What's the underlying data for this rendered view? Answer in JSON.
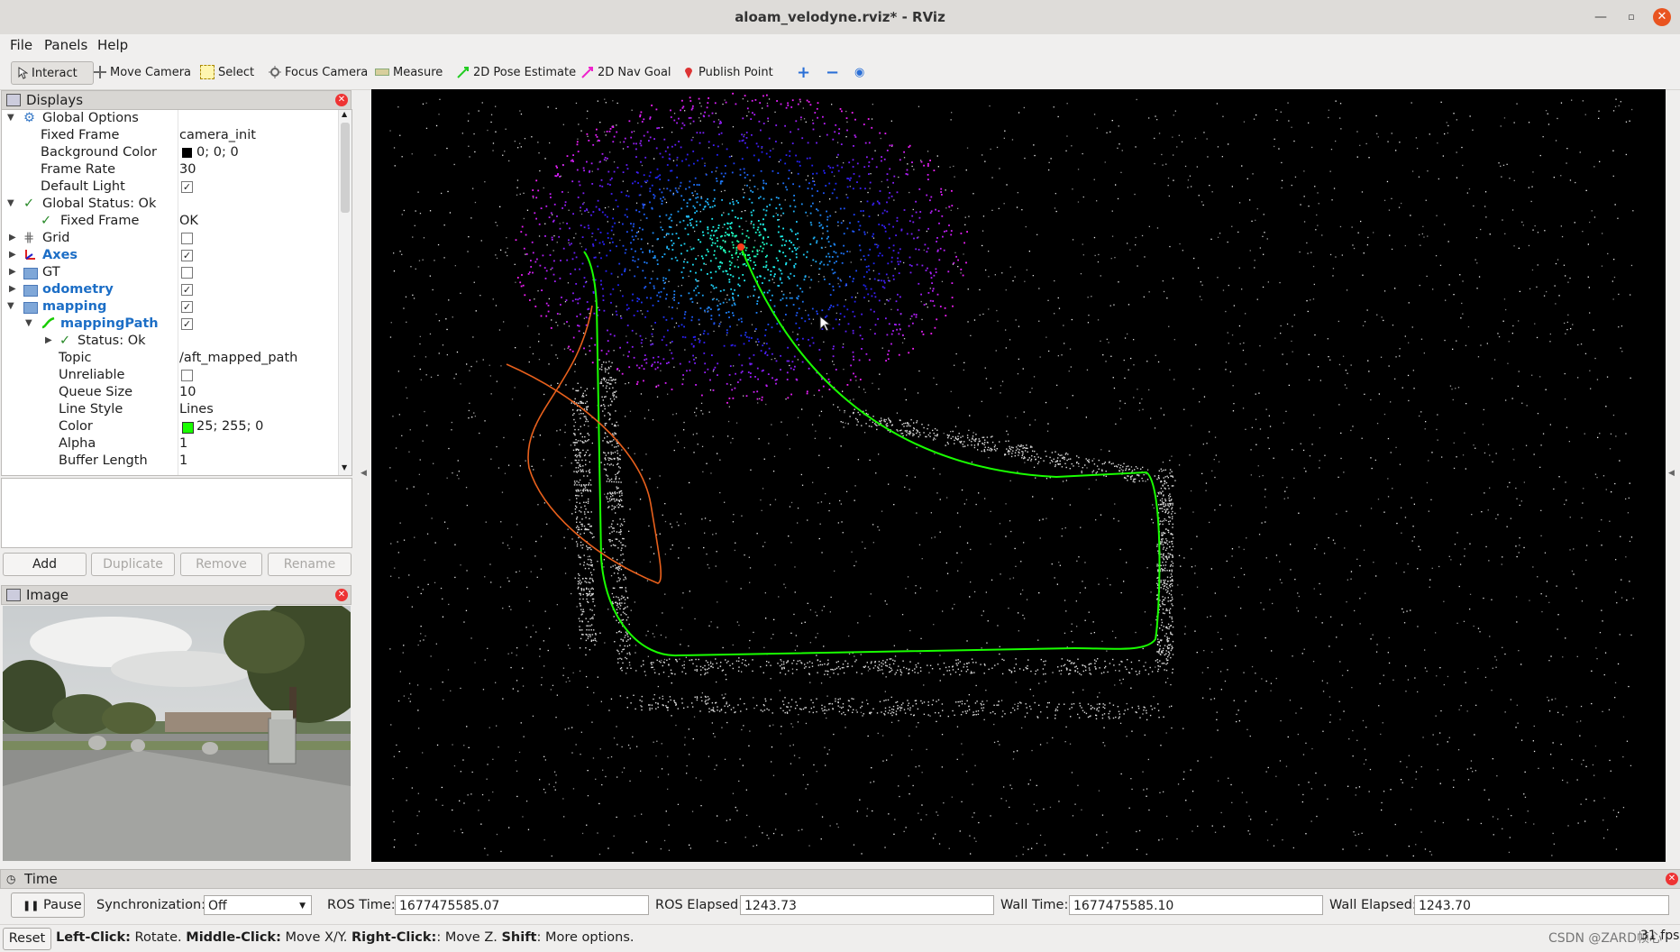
{
  "window": {
    "title": "aloam_velodyne.rviz* - RViz"
  },
  "menu": [
    "File",
    "Panels",
    "Help"
  ],
  "toolbar": {
    "interact": "Interact",
    "move_camera": "Move Camera",
    "select": "Select",
    "focus_camera": "Focus Camera",
    "measure": "Measure",
    "pose_estimate": "2D Pose Estimate",
    "nav_goal": "2D Nav Goal",
    "publish_point": "Publish Point"
  },
  "displays": {
    "title": "Displays",
    "rows": [
      {
        "name": "Global Options",
        "value": ""
      },
      {
        "name": "Fixed Frame",
        "value": "camera_init"
      },
      {
        "name": "Background Color",
        "value": "0; 0; 0"
      },
      {
        "name": "Frame Rate",
        "value": "30"
      },
      {
        "name": "Default Light",
        "value": ""
      },
      {
        "name": "Global Status: Ok",
        "value": ""
      },
      {
        "name": "Fixed Frame",
        "value": "OK"
      },
      {
        "name": "Grid",
        "value": ""
      },
      {
        "name": "Axes",
        "value": ""
      },
      {
        "name": "GT",
        "value": ""
      },
      {
        "name": "odometry",
        "value": ""
      },
      {
        "name": "mapping",
        "value": ""
      },
      {
        "name": "mappingPath",
        "value": ""
      },
      {
        "name": "Status: Ok",
        "value": ""
      },
      {
        "name": "Topic",
        "value": "/aft_mapped_path"
      },
      {
        "name": "Unreliable",
        "value": ""
      },
      {
        "name": "Queue Size",
        "value": "10"
      },
      {
        "name": "Line Style",
        "value": "Lines"
      },
      {
        "name": "Color",
        "value": "25; 255; 0"
      },
      {
        "name": "Alpha",
        "value": "1"
      },
      {
        "name": "Buffer Length",
        "value": "1"
      }
    ],
    "buttons": {
      "add": "Add",
      "duplicate": "Duplicate",
      "remove": "Remove",
      "rename": "Rename"
    }
  },
  "image_panel": {
    "title": "Image"
  },
  "time_panel": {
    "title": "Time",
    "pause": "Pause",
    "sync_label": "Synchronization:",
    "sync_value": "Off",
    "ros_time_label": "ROS Time:",
    "ros_time": "1677475585.07",
    "ros_elapsed_label": "ROS Elapsed:",
    "ros_elapsed": "1243.73",
    "wall_time_label": "Wall Time:",
    "wall_time": "1677475585.10",
    "wall_elapsed_label": "Wall Elapsed:",
    "wall_elapsed": "1243.70"
  },
  "status": {
    "reset": "Reset",
    "left_click": "Left-Click:",
    "left_text": " Rotate. ",
    "middle_click": "Middle-Click:",
    "middle_text": " Move X/Y. ",
    "right_click": "Right-Click:",
    "right_text": ": Move Z. ",
    "shift": "Shift",
    "shift_text": ": More options.",
    "fps": "31 fps",
    "watermark": "CSDN @ZARD帧心"
  },
  "colors": {
    "path_green": "#19ff00",
    "gt_orange": "#e8601c",
    "background": "#000000"
  }
}
